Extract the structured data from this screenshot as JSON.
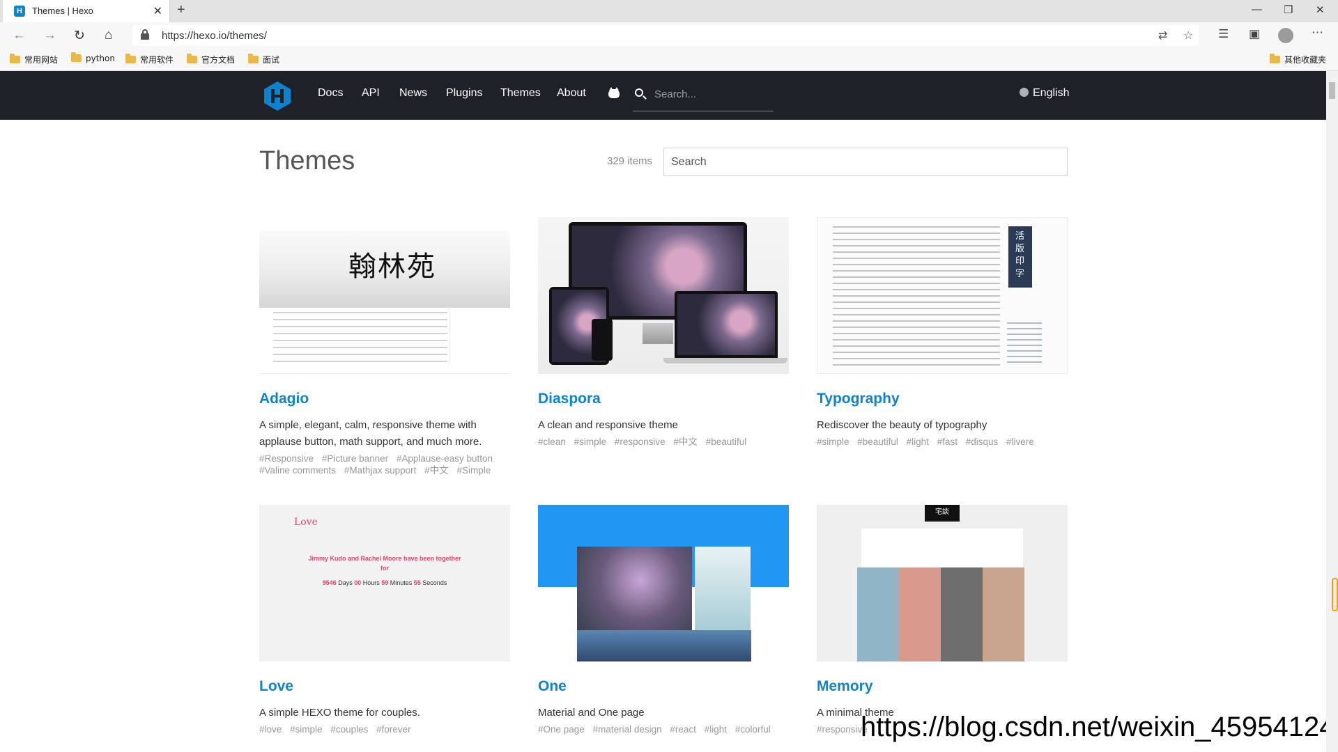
{
  "browser": {
    "tab_title": "Themes | Hexo",
    "tab_favicon": "H",
    "new_tab": "+",
    "url": "https://hexo.io/themes/",
    "window_controls": [
      "minimize-icon",
      "restore-icon",
      "close-icon"
    ],
    "bookmarks": [
      "常用网站",
      "python",
      "常用软件",
      "官方文档",
      "面试"
    ],
    "other_bookmarks": "其他收藏夹"
  },
  "site": {
    "nav": [
      "Docs",
      "API",
      "News",
      "Plugins",
      "Themes",
      "About"
    ],
    "search_placeholder": "Search...",
    "language": "English"
  },
  "themes_page": {
    "title": "Themes",
    "count": "329 items",
    "search_placeholder": "Search"
  },
  "cards": [
    {
      "name": "Adagio",
      "description": "A simple, elegant, calm, responsive theme with applause button, math support, and much more.",
      "tags": [
        "#Responsive",
        "#Picture banner",
        "#Applause-easy button",
        "#Valine comments",
        "#Mathjax support",
        "#中文",
        "#Simple"
      ],
      "thumb_title": "翰林苑"
    },
    {
      "name": "Diaspora",
      "description": "A clean and responsive theme",
      "tags": [
        "#clean",
        "#simple",
        "#responsive",
        "#中文",
        "#beautiful"
      ]
    },
    {
      "name": "Typography",
      "description": "Rediscover the beauty of typography",
      "tags": [
        "#simple",
        "#beautiful",
        "#light",
        "#fast",
        "#disqus",
        "#livere"
      ],
      "thumb_banner": "活版印字"
    },
    {
      "name": "Love",
      "description": "A simple HEXO theme for couples.",
      "tags": [
        "#love",
        "#simple",
        "#couples",
        "#forever"
      ],
      "thumb_title": "Love",
      "thumb_line1": "Jimmy Kudo and Rachel Moore have been together",
      "thumb_line2": "for",
      "thumb_counter": {
        "days": "9546",
        "hours": "00",
        "minutes": "59",
        "seconds": "55"
      }
    },
    {
      "name": "One",
      "description": "Material and One page",
      "tags": [
        "#One page",
        "#material design",
        "#react",
        "#light",
        "#colorful"
      ]
    },
    {
      "name": "Memory",
      "description": "A minimal theme",
      "tags": [
        "#responsive"
      ],
      "thumb_sign": "宅談"
    }
  ],
  "watermark": "https://blog.csdn.net/weixin_45954124"
}
